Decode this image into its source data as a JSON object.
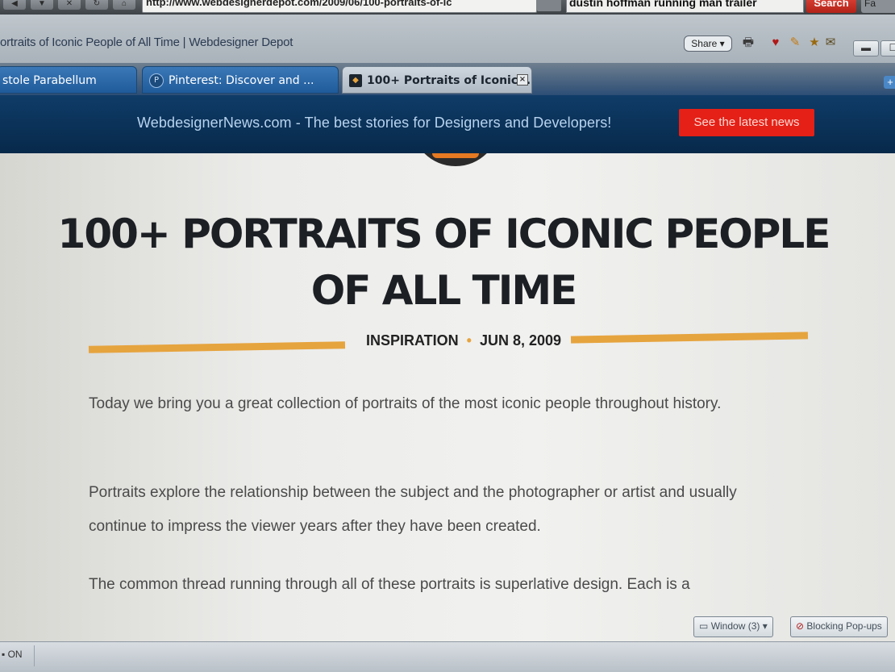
{
  "browser": {
    "address_url": "http://www.webdesignerdepot.com/2009/06/100-portraits-of-ic",
    "search_query": "dustin hoffman running man trailer",
    "search_button": "Search",
    "search_extra": "Fa",
    "window_title": "ortraits of Iconic People of All Time | Webdesigner Depot",
    "share_label": "Share",
    "tabs": [
      {
        "label": "stole Parabellum",
        "active": false
      },
      {
        "label": "Pinterest: Discover and ...",
        "active": false
      },
      {
        "label": "100+ Portraits of Iconic...",
        "active": true
      }
    ]
  },
  "banner": {
    "text": "WebdesignerNews.com - The best stories for Designers and Developers!",
    "button": "See the latest news"
  },
  "article": {
    "title_line1": "100+ PORTRAITS OF ICONIC PEOPLE",
    "title_line2": "OF ALL TIME",
    "category": "INSPIRATION",
    "date": "JUN 8, 2009",
    "paragraphs": [
      "Today we bring you a great collection of portraits of the most iconic people throughout history.",
      "Portraits explore the relationship between the subject and the photographer or artist and usually continue to impress the viewer years after they have been created.",
      "The common thread running through all of these portraits is superlative design. Each is a"
    ]
  },
  "statusbar": {
    "left_text": "ON",
    "window_button": "Window (3)",
    "popup_button": "Blocking Pop-ups"
  },
  "colors": {
    "accent_orange": "#e6a43e",
    "banner_blue": "#0f3c68",
    "news_red": "#e42017"
  }
}
